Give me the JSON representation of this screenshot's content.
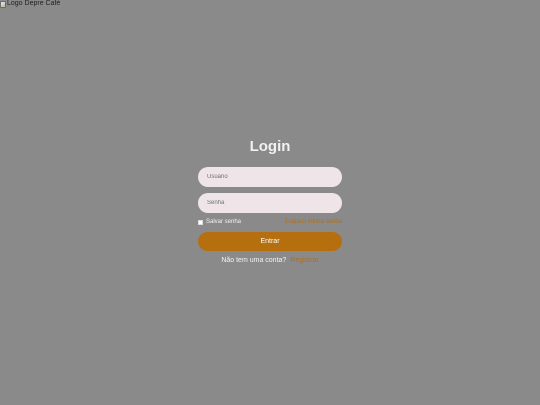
{
  "logo": {
    "alt_text": "Logo Depre Café"
  },
  "login": {
    "title": "Login",
    "username_placeholder": "Usuário",
    "password_placeholder": "Senha",
    "remember_label": "Salvar senha",
    "forgot_label": "Esqueci minha senha",
    "submit_label": "Entrar",
    "register_prompt": "Não tem uma conta?",
    "register_link": "Registrar"
  },
  "colors": {
    "background": "#8a8a8a",
    "input_fill": "#efe5e8",
    "accent": "#b56f0e",
    "link": "#b06f1c"
  },
  "icons": {
    "logo": "broken-image-icon"
  }
}
